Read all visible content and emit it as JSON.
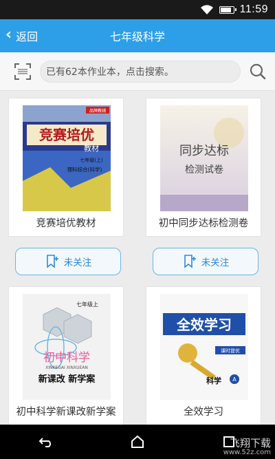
{
  "status": {
    "time": "11:59"
  },
  "header": {
    "back_label": "返回",
    "title": "七年级科学"
  },
  "search": {
    "placeholder": "已有62本作业本，点击搜索。"
  },
  "books": [
    {
      "title": "竞赛培优教材",
      "follow_label": "未关注",
      "cover_text": [
        "竞赛培优",
        "教材",
        "七年级(上)",
        "理科综合(科学)",
        "品牌教辅"
      ]
    },
    {
      "title": "初中同步达标检测卷",
      "follow_label": "未关注",
      "cover_text": [
        "同步达标",
        "检测试卷"
      ]
    },
    {
      "title": "初中科学新课改新学案",
      "follow_label": null,
      "cover_text": [
        "七年级上",
        "初中科学",
        "XINKEGAI XINXUEAN",
        "新课改 新学案"
      ]
    },
    {
      "title": "全效学习",
      "follow_label": null,
      "cover_text": [
        "全效学习",
        "课时提优",
        "科学",
        "A"
      ]
    }
  ],
  "watermark": {
    "main": "飞翔下载",
    "sub": "www.52z.com"
  },
  "colors": {
    "accent": "#2c9fe8",
    "follow_border": "#6db3e6"
  }
}
